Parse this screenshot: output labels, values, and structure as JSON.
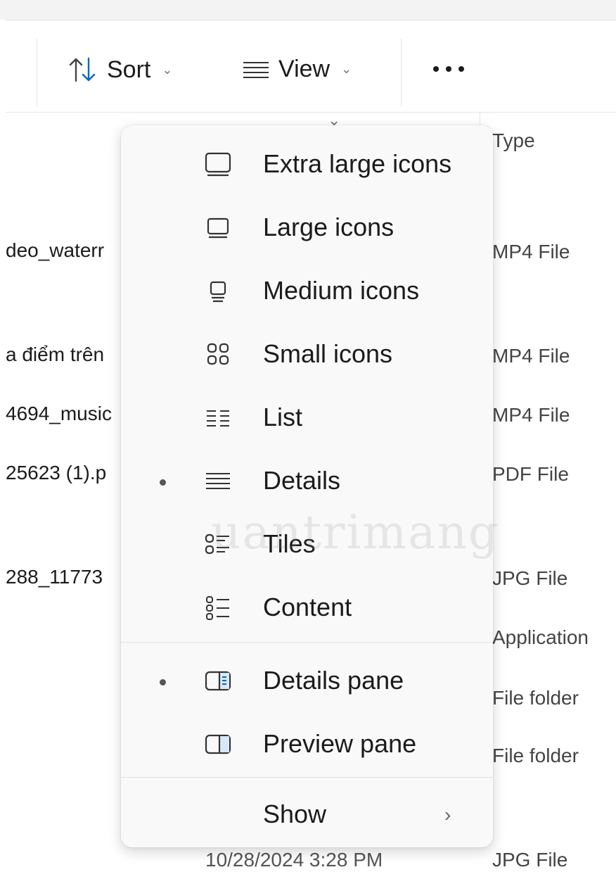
{
  "toolbar": {
    "sort_label": "Sort",
    "view_label": "View",
    "more_icon": "more-icon"
  },
  "column_headers": {
    "type": "Type"
  },
  "files": [
    {
      "name": "deo_waterr",
      "type": "MP4 File"
    },
    {
      "name": "a điểm trên",
      "type": "MP4 File"
    },
    {
      "name": "4694_music",
      "type": "MP4 File"
    },
    {
      "name": "25623 (1).p",
      "type": "PDF File"
    },
    {
      "name": "288_11773",
      "type": "JPG File"
    },
    {
      "name": "",
      "type": "Application"
    },
    {
      "name": "",
      "type": "File folder"
    },
    {
      "name": "",
      "type": "File folder"
    },
    {
      "name": "10/28/2024 3:28 PM",
      "type": "JPG File"
    }
  ],
  "view_menu": {
    "items": [
      {
        "label": "Extra large icons",
        "icon": "extra-large-icons-icon",
        "selected": false
      },
      {
        "label": "Large icons",
        "icon": "large-icons-icon",
        "selected": false
      },
      {
        "label": "Medium icons",
        "icon": "medium-icons-icon",
        "selected": false
      },
      {
        "label": "Small icons",
        "icon": "small-icons-icon",
        "selected": false
      },
      {
        "label": "List",
        "icon": "list-icon",
        "selected": false
      },
      {
        "label": "Details",
        "icon": "details-icon",
        "selected": true
      },
      {
        "label": "Tiles",
        "icon": "tiles-icon",
        "selected": false
      },
      {
        "label": "Content",
        "icon": "content-icon",
        "selected": false
      }
    ],
    "pane_items": [
      {
        "label": "Details pane",
        "icon": "details-pane-icon",
        "selected": true
      },
      {
        "label": "Preview pane",
        "icon": "preview-pane-icon",
        "selected": false
      }
    ],
    "show_label": "Show"
  },
  "watermark": "uantrimang",
  "colors": {
    "accent": "#0067c0",
    "menu_bg": "#f9f9f9"
  }
}
